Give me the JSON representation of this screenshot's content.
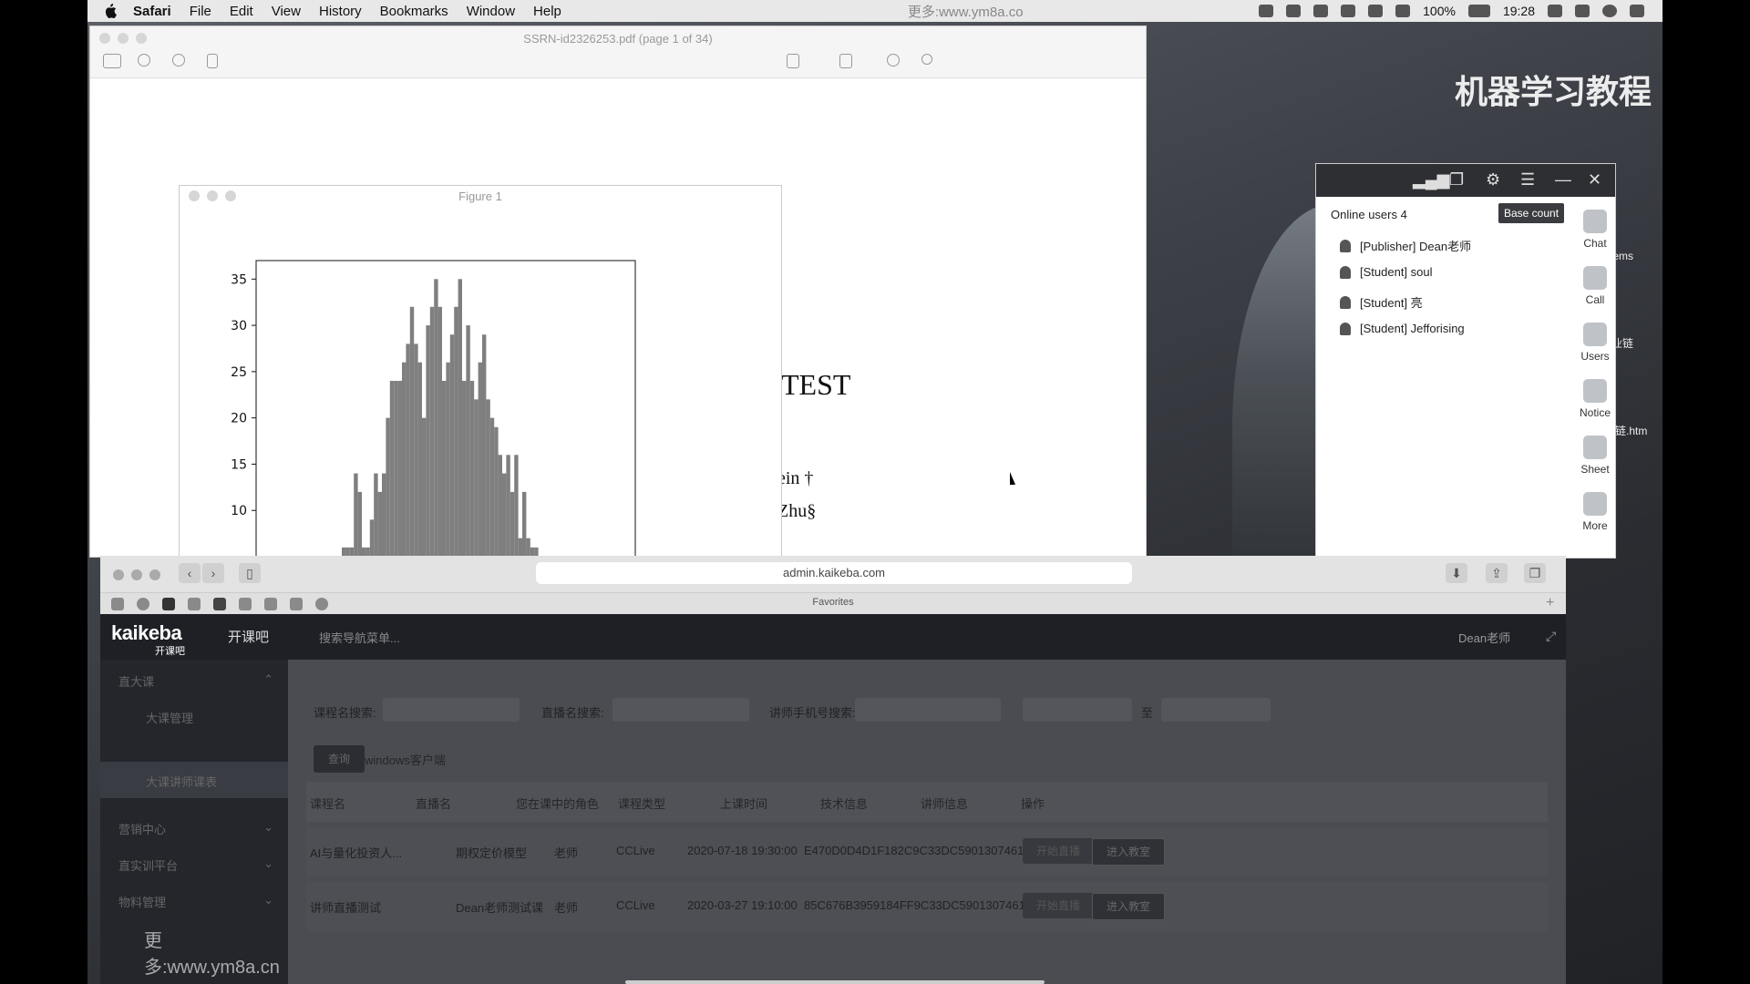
{
  "menubar": {
    "app": "Safari",
    "items": [
      "File",
      "Edit",
      "View",
      "History",
      "Bookmarks",
      "Window",
      "Help"
    ],
    "watermark": "更多:www.ym8a.co",
    "battery": "100%",
    "time": "19:28"
  },
  "preview": {
    "title": "SSRN-id2326253.pdf (page 1 of 34)",
    "heading": "TEST",
    "author_line1": "ein †",
    "author_line2": "Zhu§"
  },
  "figure": {
    "title": "Figure 1"
  },
  "chart_data": {
    "type": "bar",
    "title": "",
    "xlabel": "",
    "ylabel": "",
    "ylim": [
      5,
      37
    ],
    "yticks": [
      "35",
      "30",
      "25",
      "20",
      "15",
      "10"
    ],
    "values": [
      6,
      6,
      6,
      14,
      12,
      6,
      6,
      9,
      14,
      12,
      14,
      20,
      24,
      24,
      24,
      26,
      28,
      32,
      28,
      26,
      20,
      30,
      32,
      35,
      32,
      24,
      26,
      29,
      32,
      35,
      24,
      30,
      24,
      22,
      26,
      29,
      22,
      20,
      19,
      16,
      14,
      16,
      12,
      16,
      7,
      12,
      7,
      6,
      6,
      5
    ],
    "color": "#7f7f7f"
  },
  "desktop": {
    "watermark": "机器学习教程",
    "label_items": "tems",
    "label_link": "业链",
    "label_htm": "链.htm"
  },
  "panel": {
    "online_label": "Online users 4",
    "base_count": "Base count",
    "users": [
      "[Publisher] Dean老师",
      "[Student] soul",
      "[Student] 亮",
      "[Student] Jefforising"
    ],
    "side": [
      "Chat",
      "Call",
      "Users",
      "Notice",
      "Sheet",
      "More"
    ]
  },
  "safari": {
    "url": "admin.kaikeba.com",
    "favorites": "Favorites"
  },
  "app": {
    "brand": "kaikeba",
    "brand_sub": "开课吧",
    "nav_title": "开课吧",
    "search_menu": "搜索导航菜单...",
    "user": "Dean老师",
    "sidebar": {
      "group1": "直大课",
      "sub1": "大课管理",
      "sub2": "大课讲师课表",
      "group2": "营销中心",
      "group3": "直实训平台",
      "group4": "物料管理",
      "watermark": "更多:www.ym8a.cn"
    },
    "filters": {
      "course_label": "课程名搜索:",
      "live_label": "直播名搜索:",
      "phone_label": "讲师手机号搜索:",
      "range_sep": "至",
      "search_btn": "查询",
      "client_link": "windows客户端"
    },
    "columns": [
      "课程名",
      "直播名",
      "您在课中的角色",
      "课程类型",
      "上课时间",
      "技术信息",
      "讲师信息",
      "操作"
    ],
    "rows": [
      {
        "course": "AI与量化投资人...",
        "live": "期权定价模型",
        "role": "老师",
        "type": "CCLive",
        "time": "2020-07-18 19:30:00",
        "tech": "E470D0D4D1F182C9C33DC5901307461",
        "btn1": "开始直播",
        "btn2": "进入教室"
      },
      {
        "course": "讲师直播测试",
        "live": "Dean老师测试课",
        "role": "老师",
        "type": "CCLive",
        "time": "2020-03-27 19:10:00",
        "tech": "85C676B3959184FF9C33DC5901307461",
        "btn1": "开始直播",
        "btn2": "进入教室"
      }
    ]
  }
}
